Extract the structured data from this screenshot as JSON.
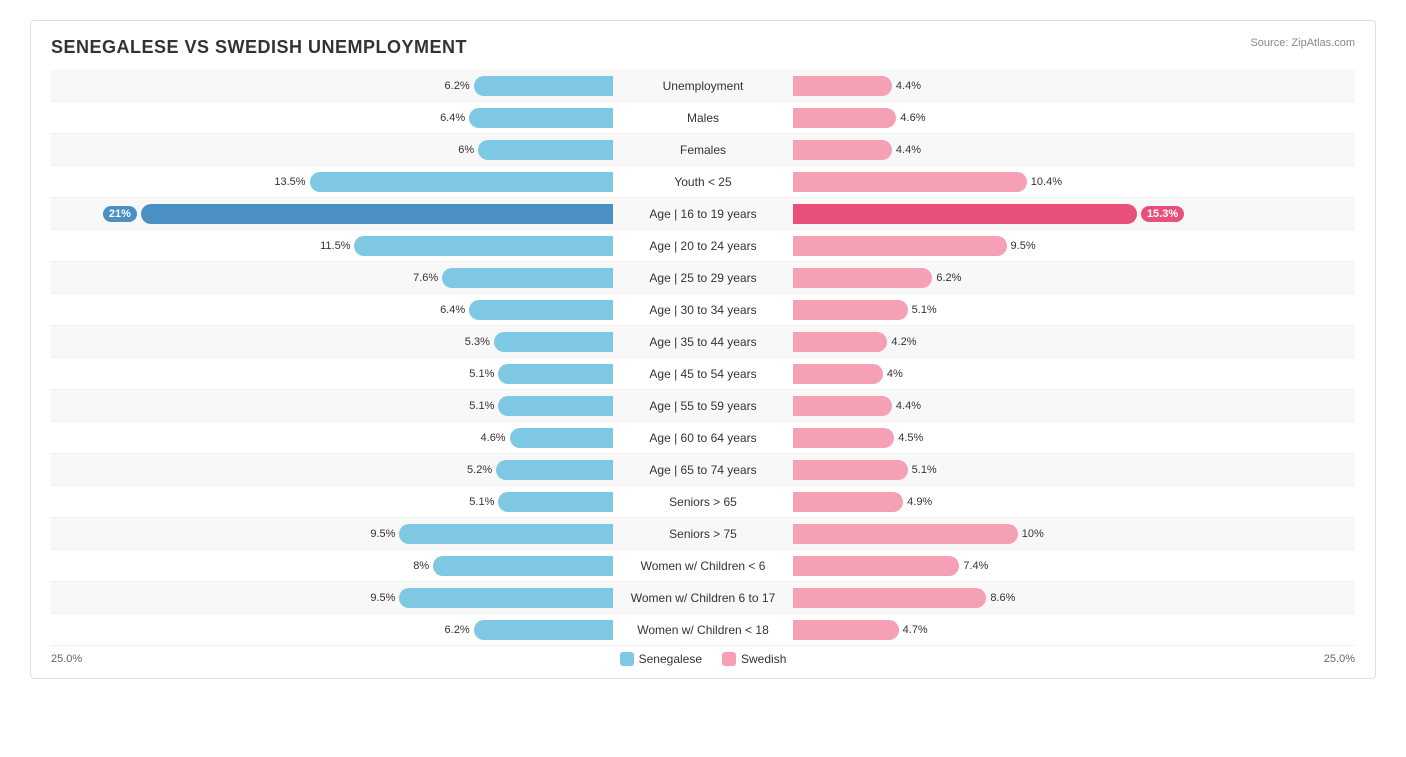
{
  "title": "SENEGALESE VS SWEDISH UNEMPLOYMENT",
  "source": "Source: ZipAtlas.com",
  "max_val": 25.0,
  "axis_left": "25.0%",
  "axis_right": "25.0%",
  "legend": {
    "senegalese_label": "Senegalese",
    "swedish_label": "Swedish"
  },
  "rows": [
    {
      "label": "Unemployment",
      "left": 6.2,
      "right": 4.4,
      "highlight": false
    },
    {
      "label": "Males",
      "left": 6.4,
      "right": 4.6,
      "highlight": false
    },
    {
      "label": "Females",
      "left": 6.0,
      "right": 4.4,
      "highlight": false
    },
    {
      "label": "Youth < 25",
      "left": 13.5,
      "right": 10.4,
      "highlight": false
    },
    {
      "label": "Age | 16 to 19 years",
      "left": 21.0,
      "right": 15.3,
      "highlight": true
    },
    {
      "label": "Age | 20 to 24 years",
      "left": 11.5,
      "right": 9.5,
      "highlight": false
    },
    {
      "label": "Age | 25 to 29 years",
      "left": 7.6,
      "right": 6.2,
      "highlight": false
    },
    {
      "label": "Age | 30 to 34 years",
      "left": 6.4,
      "right": 5.1,
      "highlight": false
    },
    {
      "label": "Age | 35 to 44 years",
      "left": 5.3,
      "right": 4.2,
      "highlight": false
    },
    {
      "label": "Age | 45 to 54 years",
      "left": 5.1,
      "right": 4.0,
      "highlight": false
    },
    {
      "label": "Age | 55 to 59 years",
      "left": 5.1,
      "right": 4.4,
      "highlight": false
    },
    {
      "label": "Age | 60 to 64 years",
      "left": 4.6,
      "right": 4.5,
      "highlight": false
    },
    {
      "label": "Age | 65 to 74 years",
      "left": 5.2,
      "right": 5.1,
      "highlight": false
    },
    {
      "label": "Seniors > 65",
      "left": 5.1,
      "right": 4.9,
      "highlight": false
    },
    {
      "label": "Seniors > 75",
      "left": 9.5,
      "right": 10.0,
      "highlight": false
    },
    {
      "label": "Women w/ Children < 6",
      "left": 8.0,
      "right": 7.4,
      "highlight": false
    },
    {
      "label": "Women w/ Children 6 to 17",
      "left": 9.5,
      "right": 8.6,
      "highlight": false
    },
    {
      "label": "Women w/ Children < 18",
      "left": 6.2,
      "right": 4.7,
      "highlight": false
    }
  ]
}
